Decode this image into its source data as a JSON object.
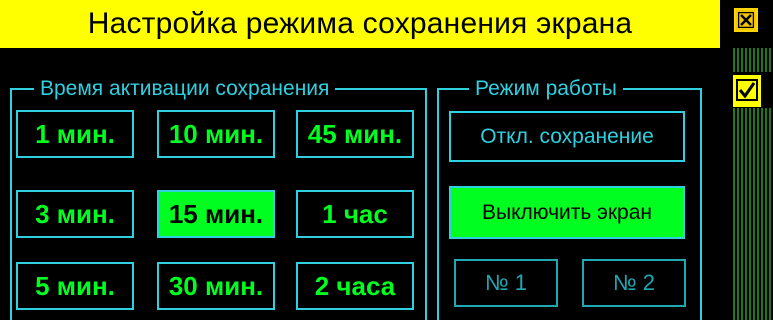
{
  "title": "Настройка режима сохранения экрана",
  "icons": {
    "close": "close-icon",
    "confirm": "checkmark-icon"
  },
  "colors": {
    "title_bg": "#ffff00",
    "accent_green": "#00ff20",
    "frame_cyan": "#2fd0e0",
    "background": "#000000"
  },
  "activation_group": {
    "legend": "Время активации сохранения",
    "selected": "15 мин.",
    "buttons": [
      {
        "label": "1 мин."
      },
      {
        "label": "10 мин."
      },
      {
        "label": "45 мин."
      },
      {
        "label": "3 мин."
      },
      {
        "label": "15 мин."
      },
      {
        "label": "1 час"
      },
      {
        "label": "5 мин."
      },
      {
        "label": "30 мин."
      },
      {
        "label": "2 часа"
      }
    ]
  },
  "mode_group": {
    "legend": "Режим работы",
    "selected": "Выключить экран",
    "buttons": [
      {
        "label": "Откл. сохранение"
      },
      {
        "label": "Выключить экран"
      },
      {
        "label": "№ 1"
      },
      {
        "label": "№ 2"
      }
    ]
  }
}
